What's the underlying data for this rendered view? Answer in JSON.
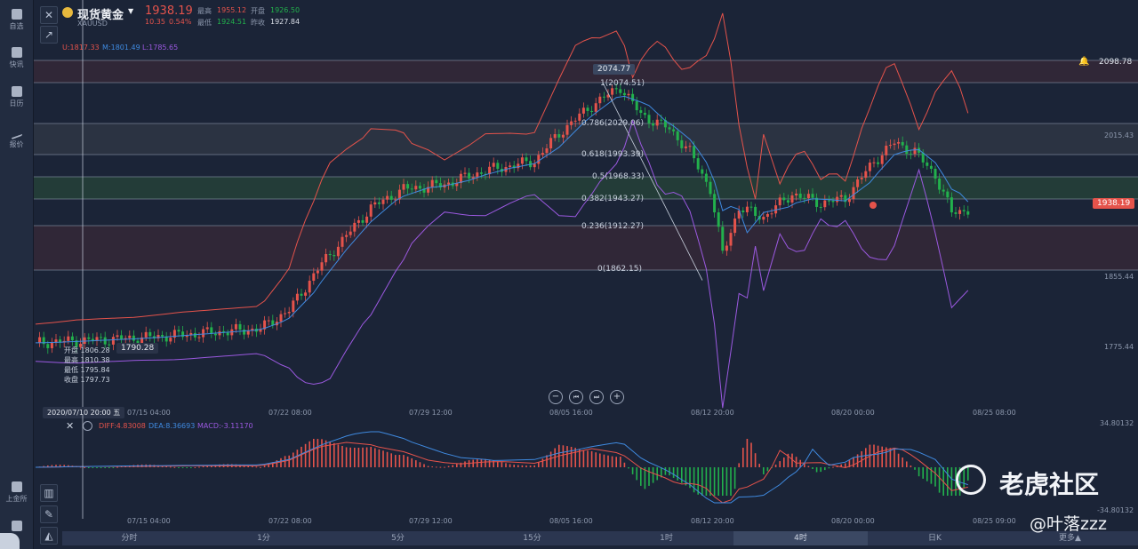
{
  "sidebar": {
    "items": [
      {
        "label": "自选",
        "icon": "bookmark-icon"
      },
      {
        "label": "快讯",
        "icon": "news-icon"
      },
      {
        "label": "日历",
        "icon": "calendar-icon"
      },
      {
        "label": "报价",
        "icon": "trend-icon"
      }
    ],
    "bottom_label": "上金所"
  },
  "header": {
    "title": "现货黄金",
    "symbol": "XAUUSD",
    "price": "1938.19",
    "change": "10.35",
    "change_pct": "0.54%",
    "high_label": "最高",
    "high": "1955.12",
    "open_label": "开盘",
    "open": "1926.50",
    "low_label": "最低",
    "low": "1924.51",
    "prev_close_label": "昨收",
    "prev_close": "1927.84"
  },
  "bands": {
    "upper": "U:1817.33",
    "middle": "M:1801.49",
    "lower": "L:1785.65"
  },
  "price_labels": {
    "alert_price": "2098.78",
    "peak": "2074.77",
    "current": "1938.19",
    "low_marker": "1790.28",
    "axis": [
      "2015.43",
      "1855.44",
      "1775.44"
    ]
  },
  "fibonacci": [
    {
      "label": "1(2074.51)"
    },
    {
      "label": "0.786(2029.06)"
    },
    {
      "label": "0.618(1993.39)"
    },
    {
      "label": "0.5(1968.33)"
    },
    {
      "label": "0.382(1943.27)"
    },
    {
      "label": "0.236(1912.27)"
    },
    {
      "label": "0(1862.15)"
    }
  ],
  "ohlc_tooltip": {
    "open": "开盘 1806.28",
    "high": "最高 1810.38",
    "low": "最低 1795.84",
    "close": "收盘 1797.73"
  },
  "crosshair_date": "2020/07/10 20:00 五",
  "x_axis": [
    "07/15 04:00",
    "07/22 08:00",
    "07/29 12:00",
    "08/05 16:00",
    "08/12 20:00",
    "08/20 00:00",
    "08/25 08:00"
  ],
  "x_axis_bottom": [
    "07/15 04:00",
    "07/22 08:00",
    "07/29 12:00",
    "08/05 16:00",
    "08/12 20:00",
    "08/20 00:00",
    "08/25 09:00"
  ],
  "macd": {
    "diff": "DIFF:4.83008",
    "dea": "DEA:8.36693",
    "macd": "MACD:-3.11170",
    "axis_top": "34.80132",
    "axis_bottom": "-34.80132"
  },
  "timeframes": [
    "分时",
    "1分",
    "5分",
    "15分",
    "1时",
    "4时",
    "日K",
    "更多▲"
  ],
  "active_timeframe": "4时",
  "watermark": {
    "brand": "老虎社区",
    "user": "@叶落zzz"
  },
  "colors": {
    "up": "#e5534b",
    "down": "#22b14c",
    "mid_band": "#3f8ae0",
    "lower_band": "#9b59e0",
    "upper_band": "#e5534b"
  }
}
